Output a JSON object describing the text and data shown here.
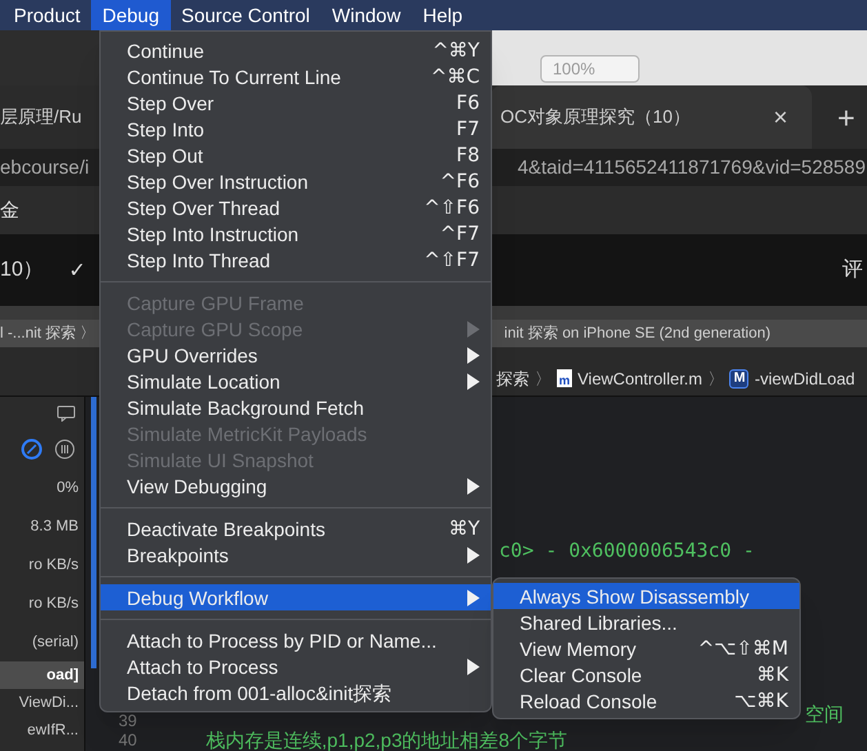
{
  "menu_bar": [
    {
      "label": "Product",
      "selected": false
    },
    {
      "label": "Debug",
      "selected": true
    },
    {
      "label": "Source Control",
      "selected": false
    },
    {
      "label": "Window",
      "selected": false
    },
    {
      "label": "Help",
      "selected": false
    }
  ],
  "browser": {
    "zoom": "100%",
    "tabs": [
      {
        "label": "层原理/Ru",
        "selected": false
      },
      {
        "label": "OC对象原理探究（10）",
        "selected": true
      }
    ],
    "tab_close": "×",
    "new_tab": "+",
    "url_left": "ebcourse/i",
    "url_right": "4&taid=4115652411871769&vid=528589",
    "bar_text": "金",
    "title_left": "10）",
    "title_check": "✓",
    "title_right": "评"
  },
  "xcode": {
    "scheme_left": "l -...nit 探索 〉",
    "scheme_right": "init 探索 on iPhone SE (2nd generation)",
    "jump_bar": {
      "group": "探索",
      "separator": "〉",
      "file_badge": "m",
      "file": "ViewController.m",
      "method_badge": "M",
      "method": "-viewDidLoad"
    },
    "navigator": [
      {
        "label": "0%",
        "selected": false
      },
      {
        "label": "8.3 MB",
        "selected": false
      },
      {
        "label": "ro KB/s",
        "selected": false
      },
      {
        "label": "ro KB/s",
        "selected": false
      },
      {
        "label": "(serial)",
        "selected": false
      },
      {
        "label": "oad]",
        "selected": true
      },
      {
        "label": "ViewDi...",
        "selected": false
      },
      {
        "label": "ewIfR...",
        "selected": false
      }
    ],
    "code": {
      "output": "c0> - 0x6000006543c0 -",
      "line_39": "39",
      "line_39_tail": "空间",
      "line_40": "40",
      "line_40_text": "栈内存是连续,p1,p2,p3的地址相差8个字节"
    }
  },
  "debug_menu": [
    {
      "kind": "item",
      "label": "Continue",
      "shortcut": "^⌘Y",
      "disabled": false,
      "selected": false
    },
    {
      "kind": "item",
      "label": "Continue To Current Line",
      "shortcut": "^⌘C",
      "disabled": false,
      "selected": false
    },
    {
      "kind": "item",
      "label": "Step Over",
      "shortcut": "F6",
      "disabled": false,
      "selected": false
    },
    {
      "kind": "item",
      "label": "Step Into",
      "shortcut": "F7",
      "disabled": false,
      "selected": false
    },
    {
      "kind": "item",
      "label": "Step Out",
      "shortcut": "F8",
      "disabled": false,
      "selected": false
    },
    {
      "kind": "item",
      "label": "Step Over Instruction",
      "shortcut": "^F6",
      "disabled": false,
      "selected": false
    },
    {
      "kind": "item",
      "label": "Step Over Thread",
      "shortcut": "^⇧F6",
      "disabled": false,
      "selected": false
    },
    {
      "kind": "item",
      "label": "Step Into Instruction",
      "shortcut": "^F7",
      "disabled": false,
      "selected": false
    },
    {
      "kind": "item",
      "label": "Step Into Thread",
      "shortcut": "^⇧F7",
      "disabled": false,
      "selected": false
    },
    {
      "kind": "separator"
    },
    {
      "kind": "item",
      "label": "Capture GPU Frame",
      "disabled": true,
      "selected": false
    },
    {
      "kind": "submenu",
      "label": "Capture GPU Scope",
      "disabled": true,
      "selected": false
    },
    {
      "kind": "submenu",
      "label": "GPU Overrides",
      "disabled": false,
      "selected": false
    },
    {
      "kind": "submenu",
      "label": "Simulate Location",
      "disabled": false,
      "selected": false
    },
    {
      "kind": "item",
      "label": "Simulate Background Fetch",
      "disabled": false,
      "selected": false
    },
    {
      "kind": "item",
      "label": "Simulate MetricKit Payloads",
      "disabled": true,
      "selected": false
    },
    {
      "kind": "item",
      "label": "Simulate UI Snapshot",
      "disabled": true,
      "selected": false
    },
    {
      "kind": "submenu",
      "label": "View Debugging",
      "disabled": false,
      "selected": false
    },
    {
      "kind": "separator"
    },
    {
      "kind": "item",
      "label": "Deactivate Breakpoints",
      "shortcut": "⌘Y",
      "disabled": false,
      "selected": false
    },
    {
      "kind": "submenu",
      "label": "Breakpoints",
      "disabled": false,
      "selected": false
    },
    {
      "kind": "separator"
    },
    {
      "kind": "submenu",
      "label": "Debug Workflow",
      "disabled": false,
      "selected": true
    },
    {
      "kind": "separator"
    },
    {
      "kind": "item",
      "label": "Attach to Process by PID or Name...",
      "disabled": false,
      "selected": false
    },
    {
      "kind": "submenu",
      "label": "Attach to Process",
      "disabled": false,
      "selected": false
    },
    {
      "kind": "item",
      "label": "Detach from 001-alloc&init探索",
      "disabled": false,
      "selected": false
    }
  ],
  "workflow_menu": [
    {
      "kind": "item",
      "label": "Always Show Disassembly",
      "disabled": false,
      "selected": true
    },
    {
      "kind": "item",
      "label": "Shared Libraries...",
      "disabled": false,
      "selected": false
    },
    {
      "kind": "item",
      "label": "View Memory",
      "shortcut": "^⌥⇧⌘M",
      "disabled": false,
      "selected": false
    },
    {
      "kind": "item",
      "label": "Clear Console",
      "shortcut": "⌘K",
      "disabled": false,
      "selected": false
    },
    {
      "kind": "item",
      "label": "Reload Console",
      "shortcut": "⌥⌘K",
      "disabled": false,
      "selected": false
    }
  ]
}
